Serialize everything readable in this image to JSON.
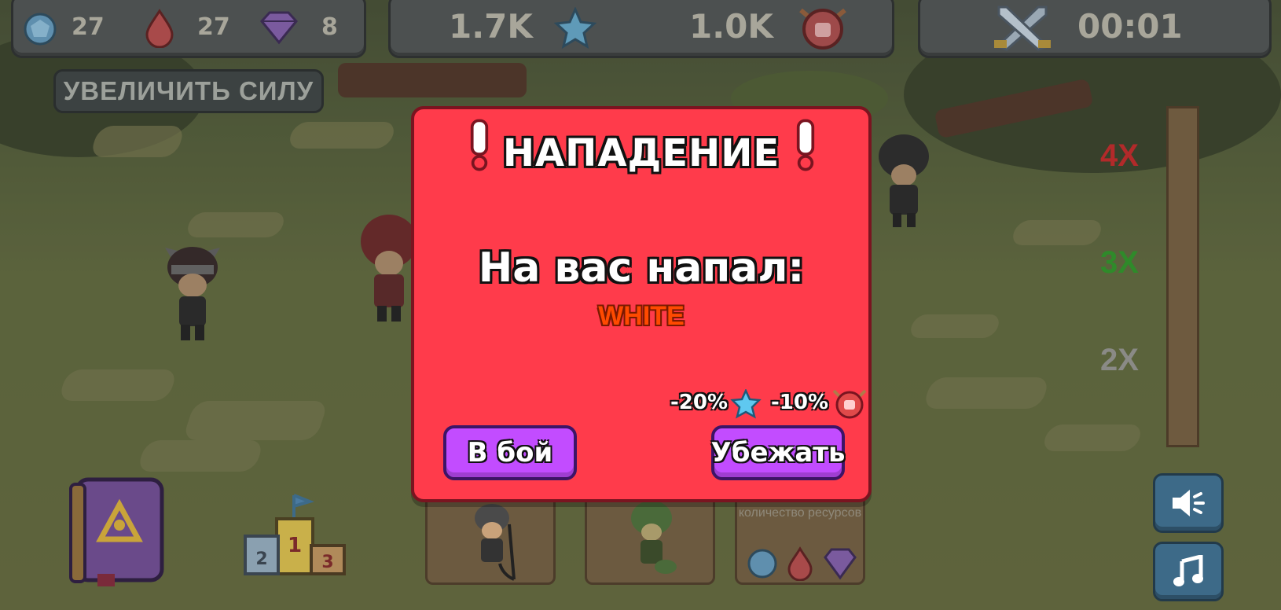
{
  "hud": {
    "crystals": "27",
    "blood": "27",
    "gems": "8",
    "stars_total": "1.7K",
    "power_total": "1.0K",
    "timer": "00:01"
  },
  "boost_button": "УВЕЛИЧИТЬ СИЛУ",
  "multipliers": {
    "m4": "4X",
    "m3": "3X",
    "m2": "2X",
    "colors": {
      "m4": "#b22a2a",
      "m3": "#2f8a2a",
      "m2": "#8a8a86"
    }
  },
  "cards": {
    "resources_text": "количество ресурсов"
  },
  "modal": {
    "title": "НАПАДЕНИЕ",
    "attack_label": "На вас напал:",
    "attacker_name": "WHITE",
    "penalty_stars": "-20%",
    "penalty_power": "-10%",
    "fight_button": "В бой",
    "flee_button": "Убежать"
  },
  "colors": {
    "modal_bg": "#ff3b4b",
    "button_purple": "#c24cff",
    "attacker": "#ff4a00"
  },
  "icons": [
    "crystal-icon",
    "blood-drop-icon",
    "gem-icon",
    "star-icon",
    "power-shield-icon",
    "crossed-swords-icon",
    "spellbook-icon",
    "podium-icon",
    "speaker-icon",
    "music-note-icon"
  ]
}
